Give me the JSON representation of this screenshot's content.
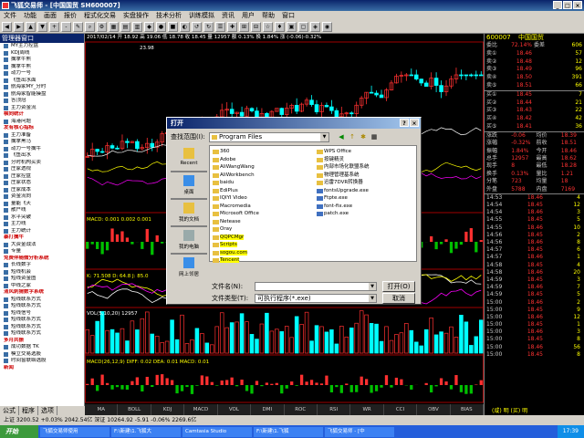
{
  "window": {
    "title": "飞狐交易师 - [中国国贸 SH600007]"
  },
  "menu": [
    "文件",
    "功能",
    "画面",
    "报价",
    "程式化交易",
    "实盘操作",
    "技术分析",
    "训练模拟",
    "资讯",
    "用户",
    "帮助",
    "窗口"
  ],
  "left_panel": {
    "title": "管理器窗口",
    "items": [
      {
        "label": "MY主力控盘",
        "cat": false
      },
      {
        "label": "KDJ周线",
        "cat": false
      },
      {
        "label": "擒拿牛熊",
        "cat": false
      },
      {
        "label": "擒拿牛熊",
        "cat": false
      },
      {
        "label": "动力一号",
        "cat": false
      },
      {
        "label": "飞鱼出水面",
        "cat": false
      },
      {
        "label": "航海家MY_分时",
        "cat": false
      },
      {
        "label": "航海家智能操盘",
        "cat": false
      },
      {
        "label": "答顶冠",
        "cat": false
      },
      {
        "label": "主力资金流",
        "cat": false
      },
      {
        "label": "横向统计",
        "cat": true
      },
      {
        "label": "海港问题",
        "cat": false
      },
      {
        "label": "发有核心指标",
        "cat": true
      },
      {
        "label": "主力准备",
        "cat": false
      },
      {
        "label": "擒拿黑马",
        "cat": false
      },
      {
        "label": "动力一号擒牛",
        "cat": false
      },
      {
        "label": "飞鱼出水",
        "cat": false
      },
      {
        "label": "分时机构买卖",
        "cat": false
      },
      {
        "label": "庄家透视",
        "cat": false
      },
      {
        "label": "庄家控盘",
        "cat": false
      },
      {
        "label": "庄家状态",
        "cat": false
      },
      {
        "label": "庄家成本",
        "cat": false
      },
      {
        "label": "资金流向",
        "cat": false
      },
      {
        "label": "量能飞天",
        "cat": false
      },
      {
        "label": "散户线",
        "cat": false
      },
      {
        "label": "水平突破",
        "cat": false
      },
      {
        "label": "主力线",
        "cat": false
      },
      {
        "label": "主力统计",
        "cat": false
      },
      {
        "label": "暴打擒牛",
        "cat": true
      },
      {
        "label": "大资金战法",
        "cat": false
      },
      {
        "label": "专量",
        "cat": false
      },
      {
        "label": "免费伴随微分析系统",
        "cat": true
      },
      {
        "label": "长线数字",
        "cat": false
      },
      {
        "label": "短线机会",
        "cat": false
      },
      {
        "label": "短线资金图",
        "cat": false
      },
      {
        "label": "中线之家",
        "cat": false
      },
      {
        "label": "清风刺猬数字系统",
        "cat": true
      },
      {
        "label": "短线联系方式",
        "cat": false
      },
      {
        "label": "短线联系方式",
        "cat": false
      },
      {
        "label": "短线信号",
        "cat": false
      },
      {
        "label": "短线联系方式",
        "cat": false
      },
      {
        "label": "短线联系方式",
        "cat": false
      },
      {
        "label": "短线联系方式",
        "cat": false
      },
      {
        "label": "多月共振",
        "cat": true
      },
      {
        "label": "成功数据 TK",
        "cat": false
      },
      {
        "label": "模立交易选股",
        "cat": false
      },
      {
        "label": "时间窗联络选股",
        "cat": false
      },
      {
        "label": "新闻",
        "cat": true
      }
    ],
    "tabs": [
      "公式",
      "程序",
      "选项"
    ]
  },
  "chart": {
    "info_main": "2017/02/14 开 18.92 高 19.06 低 18.78 收 18.45 量 12957 额 0.13% 换 1.84% 涨 (-0.06)-0.32%",
    "info_macd": "MACD: 0.001 0.002 0.001",
    "info_kdj": "K: 71.508 D: 64.8 J: 85.0",
    "info_vol": "VOL(5,10,20) 12957",
    "info_bottom": "MACD(26,12,9) DIFF: 0.02 DEA: 0.01 MACD: 0.01",
    "price_hi": "23.98",
    "price_lo": "18.28",
    "bottom_tabs": [
      "MA",
      "BOLL",
      "KDJ",
      "MACD",
      "VOL",
      "DMI",
      "ROC",
      "RSI",
      "WR",
      "CCI",
      "OBV",
      "BIAS"
    ],
    "colors": {
      "up": "#ff3030",
      "down": "#00ffff",
      "bg": "#000000"
    }
  },
  "right_panel": {
    "code": "600007",
    "name": "中国国贸",
    "order_ratio_label": "委比",
    "order_ratio": "72.14%",
    "order_diff_label": "委差",
    "order_diff": "606",
    "asks": [
      {
        "label": "卖⑤",
        "price": "18.51",
        "vol": "66"
      },
      {
        "label": "卖④",
        "price": "18.50",
        "vol": "391"
      },
      {
        "label": "卖③",
        "price": "18.49",
        "vol": "96"
      },
      {
        "label": "卖②",
        "price": "18.48",
        "vol": "12"
      },
      {
        "label": "卖①",
        "price": "18.46",
        "vol": "57"
      }
    ],
    "bids": [
      {
        "label": "买①",
        "price": "18.45",
        "vol": "7"
      },
      {
        "label": "买②",
        "price": "18.44",
        "vol": "21"
      },
      {
        "label": "买③",
        "price": "18.43",
        "vol": "22"
      },
      {
        "label": "买④",
        "price": "18.42",
        "vol": "42"
      },
      {
        "label": "买⑤",
        "price": "18.41",
        "vol": "36"
      }
    ],
    "stats": [
      [
        "涨跌",
        "-0.06",
        "均价",
        "18.39"
      ],
      [
        "涨幅",
        "-0.32%",
        "前收",
        "18.51"
      ],
      [
        "振幅",
        "1.84%",
        "今开",
        "18.46"
      ],
      [
        "总手",
        "12957",
        "最高",
        "18.62"
      ],
      [
        "现手",
        "8",
        "最低",
        "18.28"
      ],
      [
        "换手",
        "0.13%",
        "量比",
        "1.21"
      ],
      [
        "分笔",
        "723",
        "均量",
        "18"
      ],
      [
        "外盘",
        "5788",
        "内盘",
        "7169"
      ]
    ],
    "ticks": [
      [
        "14:53",
        "18.46",
        "4"
      ],
      [
        "14:54",
        "18.45",
        "12"
      ],
      [
        "14:54",
        "18.46",
        "3"
      ],
      [
        "14:55",
        "18.45",
        "5"
      ],
      [
        "14:55",
        "18.46",
        "10"
      ],
      [
        "14:56",
        "18.45",
        "2"
      ],
      [
        "14:56",
        "18.46",
        "8"
      ],
      [
        "14:57",
        "18.45",
        "6"
      ],
      [
        "14:57",
        "18.46",
        "1"
      ],
      [
        "14:58",
        "18.45",
        "4"
      ],
      [
        "14:58",
        "18.46",
        "20"
      ],
      [
        "14:59",
        "18.45",
        "3"
      ],
      [
        "14:59",
        "18.46",
        "7"
      ],
      [
        "14:59",
        "18.45",
        "5"
      ],
      [
        "15:00",
        "18.46",
        "2"
      ],
      [
        "15:00",
        "18.45",
        "9"
      ],
      [
        "15:00",
        "18.46",
        "12"
      ],
      [
        "15:00",
        "18.45",
        "1"
      ],
      [
        "15:00",
        "18.46",
        "3"
      ],
      [
        "15:00",
        "18.45",
        "8"
      ],
      [
        "15:00",
        "18.46",
        "56"
      ],
      [
        "15:00",
        "18.45",
        "8"
      ]
    ],
    "bottom_label": "(咸) 明 (买) 明"
  },
  "dialog": {
    "title": "打开",
    "look_in_label": "查找范围(I):",
    "look_in_value": "Program Files",
    "places": [
      "Recent",
      "桌面",
      "我的文档",
      "我的电脑",
      "网上邻居"
    ],
    "files_col1": [
      "360",
      "Adobe",
      "AliWangWang",
      "AliWorkbench",
      "baidu",
      "EdiPlus",
      "IQIYI Video",
      "Macromedia",
      "Microsoft Office",
      "Netease",
      "Oray",
      "QQPCMgr",
      "Scripts",
      "sogou.com",
      "Tencent"
    ],
    "files_col2": [
      "WPS Office",
      "按键精灵",
      "内部市场化联盟系统",
      "物理管理基系统",
      "迅雷7DVR转换器",
      "fontsUpgrade.exe",
      "Ftpte.exe",
      "font-fix.exe",
      "patch.exe"
    ],
    "file_name_label": "文件名(N):",
    "file_name_value": "",
    "file_type_label": "文件类型(T):",
    "file_type_value": "可执行程序(*.exe)",
    "open_button": "打开(O)",
    "cancel_button": "取消"
  },
  "status_bar": "上证 3200.52 +0.03% 2042.54亿 深证 10264.92 -5.91 -0.06% 2269.6亿",
  "taskbar": {
    "start": "开始",
    "tasks": [
      "飞狐交易师使用",
      "F:\\新建\\1.飞狐大",
      "Camtasia Studio",
      "F:\\新建\\1.飞狐",
      "飞狐交易师 - [中"
    ],
    "clock": "17:39"
  }
}
